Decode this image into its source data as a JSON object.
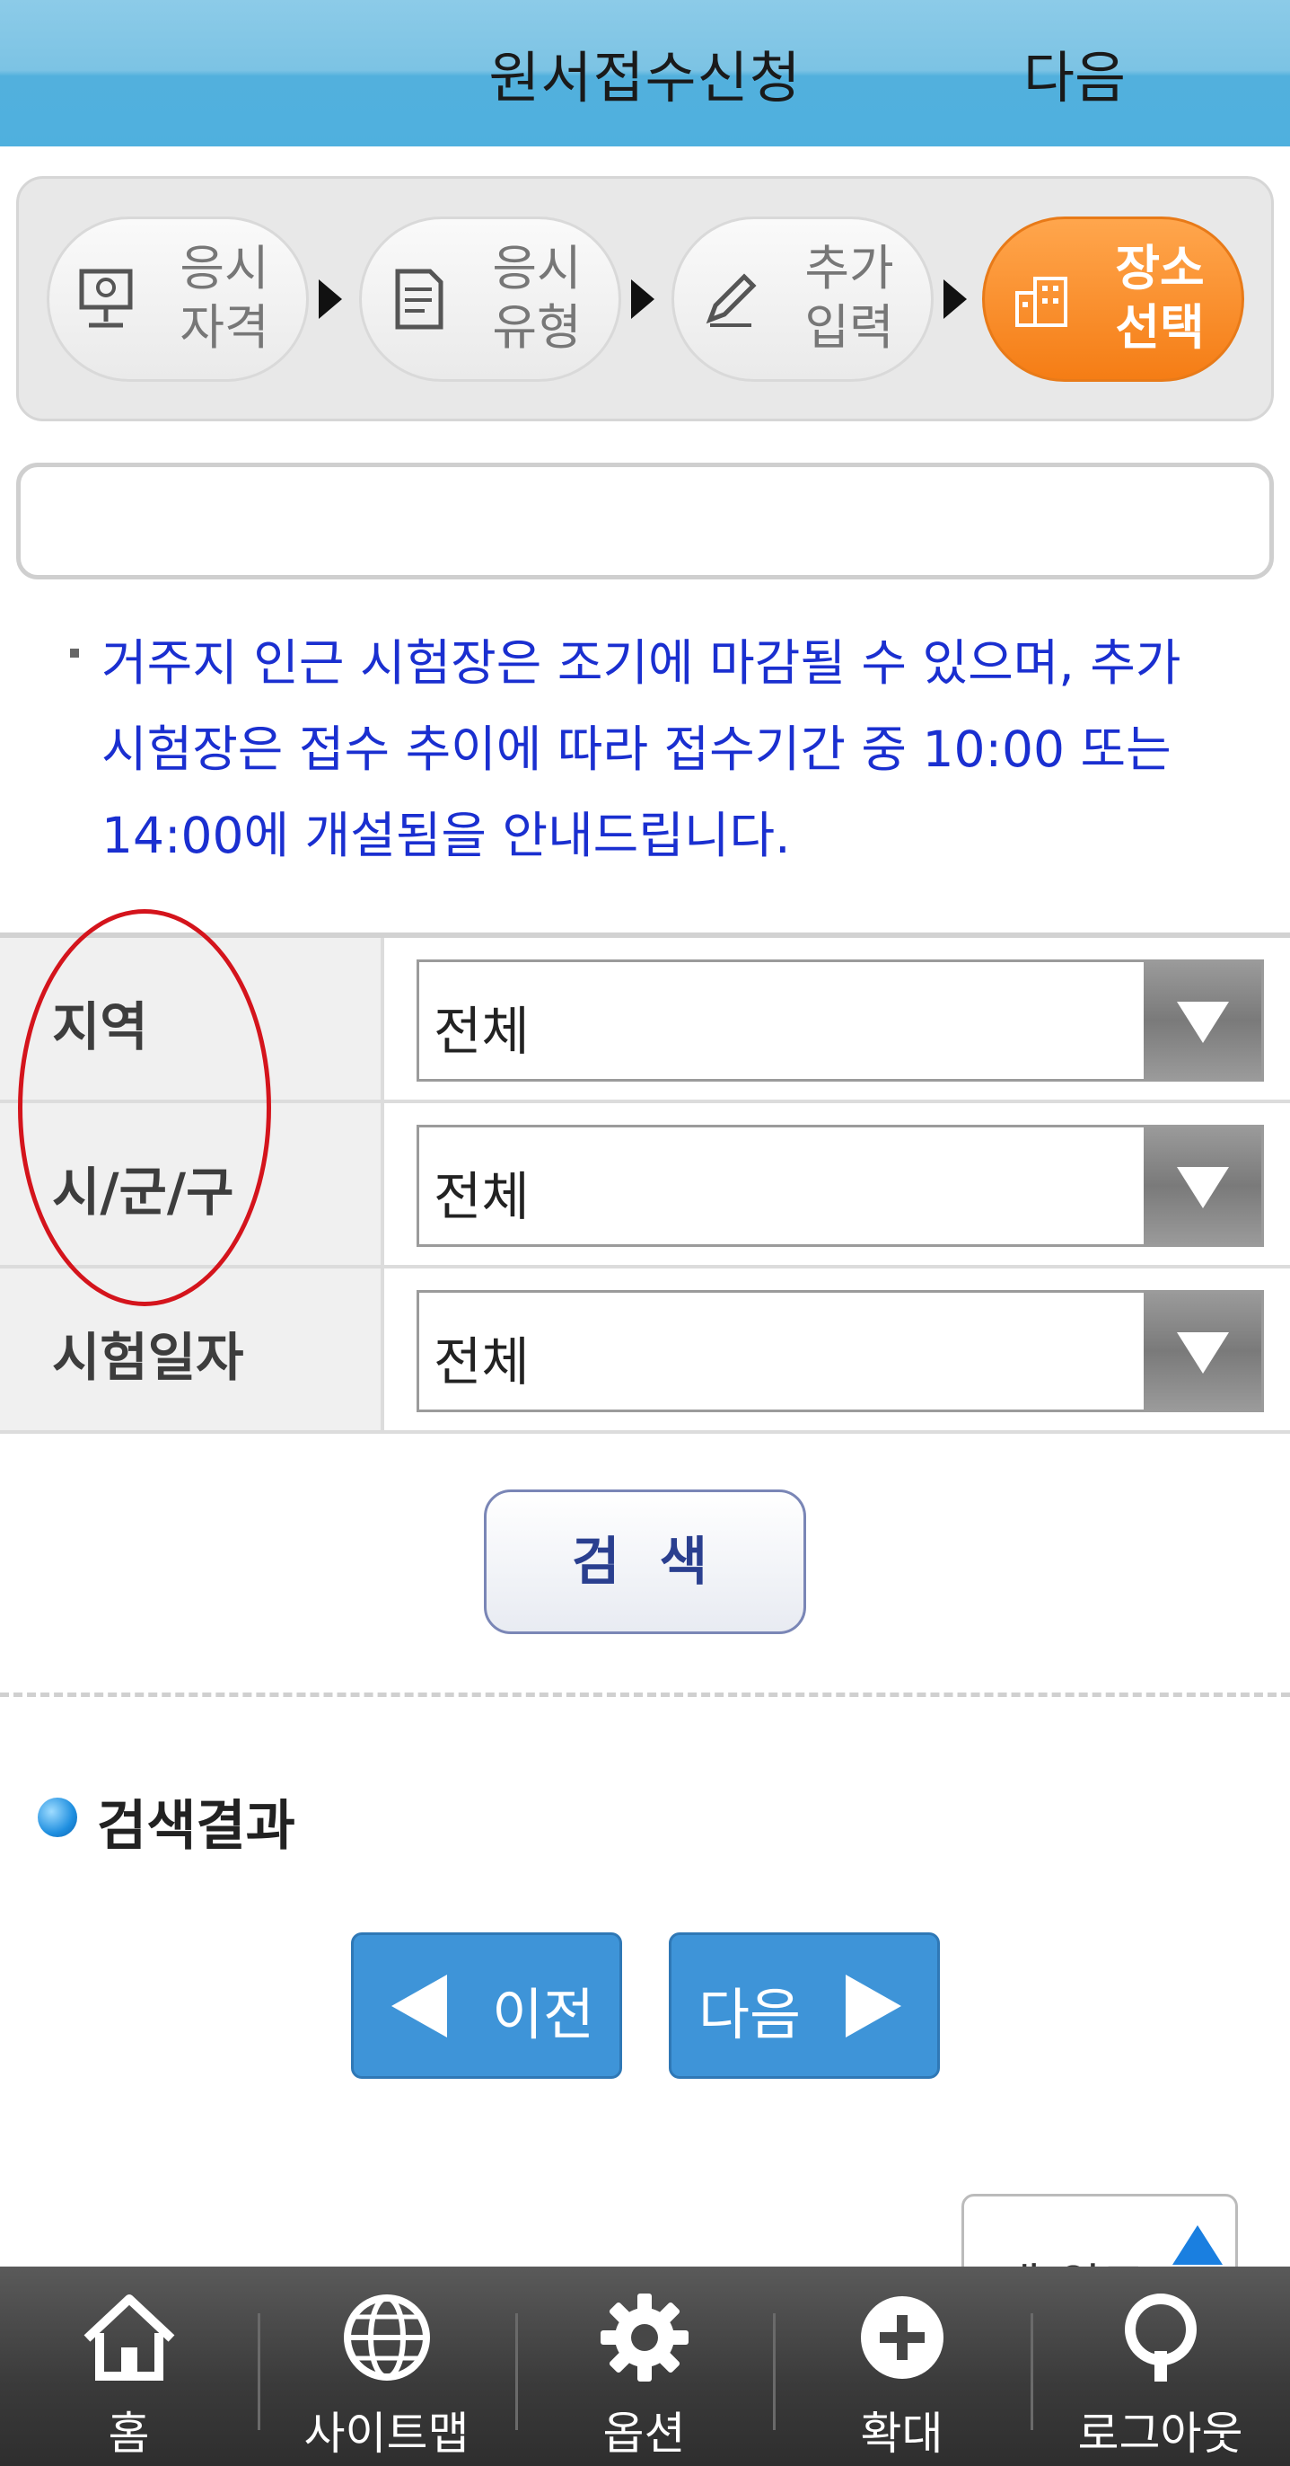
{
  "header": {
    "title": "원서접수신청",
    "next_label": "다음"
  },
  "steps": [
    {
      "label": "응시\n자격",
      "icon": "presentation-board-icon",
      "active": false
    },
    {
      "label": "응시\n유형",
      "icon": "document-icon",
      "active": false
    },
    {
      "label": "추가\n입력",
      "icon": "pencil-icon",
      "active": false
    },
    {
      "label": "장소\n선택",
      "icon": "building-icon",
      "active": true
    }
  ],
  "notice": "거주지 인근 시험장은 조기에 마감될 수 있으며, 추가 시험장은 접수 추이에 따라 접수기간 중 10:00 또는 14:00에 개설됨을 안내드립니다.",
  "form": {
    "rows": [
      {
        "label": "지역",
        "value": "전체"
      },
      {
        "label": "시/군/구",
        "value": "전체"
      },
      {
        "label": "시험일자",
        "value": "전체"
      }
    ],
    "search_label": "검 색"
  },
  "results": {
    "title": "검색결과",
    "prev_label": "이전",
    "next_label": "다음"
  },
  "to_top_label": "맨 위로",
  "bottom_nav": [
    {
      "label": "홈",
      "icon": "home-icon"
    },
    {
      "label": "사이트맵",
      "icon": "globe-icon"
    },
    {
      "label": "옵션",
      "icon": "gear-icon"
    },
    {
      "label": "확대",
      "icon": "plus-circle-icon"
    },
    {
      "label": "로그아웃",
      "icon": "logout-icon"
    }
  ],
  "colors": {
    "header": "#52b0dd",
    "active_step": "#f57d15",
    "notice_text": "#1a2fd0",
    "nav_button": "#3e94d8",
    "annotation_circle": "#d4141c"
  }
}
